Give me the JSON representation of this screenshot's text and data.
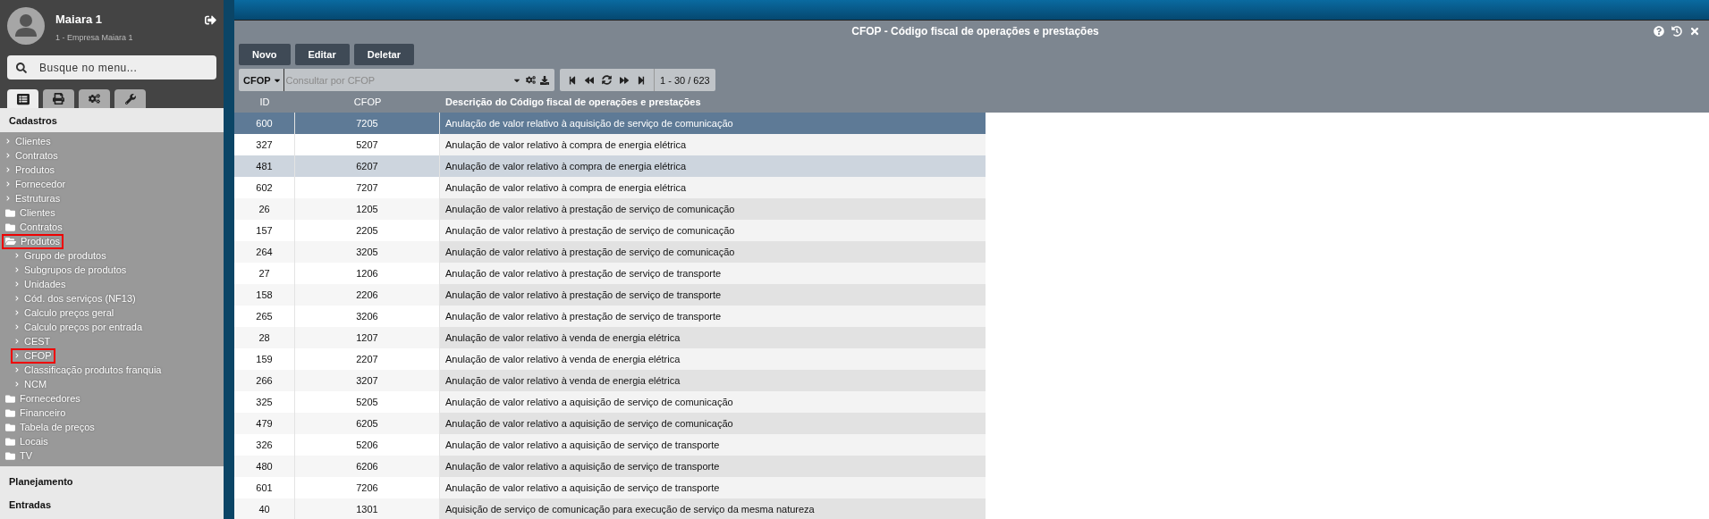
{
  "sidebar": {
    "user": {
      "name": "Maiara 1",
      "company": "1 - Empresa Maiara 1"
    },
    "search": {
      "placeholder": "Busque no menu..."
    },
    "tabs": [
      {
        "kind": "list",
        "selected": true
      },
      {
        "kind": "print",
        "selected": false
      },
      {
        "kind": "gears",
        "selected": false
      },
      {
        "kind": "wrench",
        "selected": false
      }
    ],
    "sections": [
      {
        "title": "Cadastros",
        "items": [
          {
            "kind": "link",
            "label": "Clientes",
            "marked": false
          },
          {
            "kind": "link",
            "label": "Contratos",
            "marked": false
          },
          {
            "kind": "link",
            "label": "Produtos",
            "marked": false
          },
          {
            "kind": "link",
            "label": "Fornecedor",
            "marked": false
          },
          {
            "kind": "link",
            "label": "Estruturas",
            "marked": false
          },
          {
            "kind": "folder",
            "label": "Clientes",
            "open": false,
            "marked": false
          },
          {
            "kind": "folder",
            "label": "Contratos",
            "open": false,
            "marked": false
          },
          {
            "kind": "folder",
            "label": "Produtos",
            "open": true,
            "marked": true,
            "children": [
              {
                "kind": "link",
                "label": "Grupo de produtos",
                "marked": false
              },
              {
                "kind": "link",
                "label": "Subgrupos de produtos",
                "marked": false
              },
              {
                "kind": "link",
                "label": "Unidades",
                "marked": false
              },
              {
                "kind": "link",
                "label": "Cód. dos serviços (NF13)",
                "marked": false
              },
              {
                "kind": "link",
                "label": "Calculo preços geral",
                "marked": false
              },
              {
                "kind": "link",
                "label": "Calculo preços por entrada",
                "marked": false
              },
              {
                "kind": "link",
                "label": "CEST",
                "marked": false
              },
              {
                "kind": "link",
                "label": "CFOP",
                "marked": true
              },
              {
                "kind": "link",
                "label": "Classificação produtos franquia",
                "marked": false
              },
              {
                "kind": "link",
                "label": "NCM",
                "marked": false
              }
            ]
          },
          {
            "kind": "folder",
            "label": "Fornecedores",
            "open": false,
            "marked": false
          },
          {
            "kind": "folder",
            "label": "Financeiro",
            "open": false,
            "marked": false
          },
          {
            "kind": "folder",
            "label": "Tabela de preços",
            "open": false,
            "marked": false
          },
          {
            "kind": "folder",
            "label": "Locais",
            "open": false,
            "marked": false
          },
          {
            "kind": "folder",
            "label": "TV",
            "open": false,
            "marked": false
          }
        ]
      },
      {
        "title": "Planejamento"
      },
      {
        "title": "Entradas"
      }
    ]
  },
  "window": {
    "title": "CFOP - Código fiscal de operações e prestações",
    "buttons": [
      "Novo",
      "Editar",
      "Deletar"
    ],
    "filter": {
      "field": "CFOP",
      "placeholder": "Consultar por CFOP"
    },
    "pager": "1 - 30 / 623",
    "table": {
      "columns": [
        "ID",
        "CFOP",
        "Descrição do Código fiscal de operações e prestações"
      ],
      "rows": [
        {
          "cells": [
            "600",
            "7205",
            "Anulação de valor relativo à aquisição de serviço de comunicação"
          ],
          "selected": true,
          "hovered": false
        },
        {
          "cells": [
            "327",
            "5207",
            "Anulação de valor relativo à compra de energia elétrica"
          ],
          "selected": false,
          "hovered": false
        },
        {
          "cells": [
            "481",
            "6207",
            "Anulação de valor relativo à compra de energia elétrica"
          ],
          "selected": false,
          "hovered": true
        },
        {
          "cells": [
            "602",
            "7207",
            "Anulação de valor relativo à compra de energia elétrica"
          ],
          "selected": false,
          "hovered": false
        },
        {
          "cells": [
            "26",
            "1205",
            "Anulação de valor relativo à prestação de serviço de comunicação"
          ],
          "selected": false,
          "hovered": false
        },
        {
          "cells": [
            "157",
            "2205",
            "Anulação de valor relativo à prestação de serviço de comunicação"
          ],
          "selected": false,
          "hovered": false
        },
        {
          "cells": [
            "264",
            "3205",
            "Anulação de valor relativo à prestação de serviço de comunicação"
          ],
          "selected": false,
          "hovered": false
        },
        {
          "cells": [
            "27",
            "1206",
            "Anulação de valor relativo à prestação de serviço de transporte"
          ],
          "selected": false,
          "hovered": false
        },
        {
          "cells": [
            "158",
            "2206",
            "Anulação de valor relativo à prestação de serviço de transporte"
          ],
          "selected": false,
          "hovered": false
        },
        {
          "cells": [
            "265",
            "3206",
            "Anulação de valor relativo à prestação de serviço de transporte"
          ],
          "selected": false,
          "hovered": false
        },
        {
          "cells": [
            "28",
            "1207",
            "Anulação de valor relativo à venda de energia elétrica"
          ],
          "selected": false,
          "hovered": false
        },
        {
          "cells": [
            "159",
            "2207",
            "Anulação de valor relativo à venda de energia elétrica"
          ],
          "selected": false,
          "hovered": false
        },
        {
          "cells": [
            "266",
            "3207",
            "Anulação de valor relativo à venda de energia elétrica"
          ],
          "selected": false,
          "hovered": false
        },
        {
          "cells": [
            "325",
            "5205",
            "Anulação de valor relativo a aquisição de serviço de comunicação"
          ],
          "selected": false,
          "hovered": false
        },
        {
          "cells": [
            "479",
            "6205",
            "Anulação de valor relativo a aquisição de serviço de comunicação"
          ],
          "selected": false,
          "hovered": false
        },
        {
          "cells": [
            "326",
            "5206",
            "Anulação de valor relativo a aquisição de serviço de transporte"
          ],
          "selected": false,
          "hovered": false
        },
        {
          "cells": [
            "480",
            "6206",
            "Anulação de valor relativo a aquisição de serviço de transporte"
          ],
          "selected": false,
          "hovered": false
        },
        {
          "cells": [
            "601",
            "7206",
            "Anulação de valor relativo a aquisição de serviço de transporte"
          ],
          "selected": false,
          "hovered": false
        },
        {
          "cells": [
            "40",
            "1301",
            "Aquisição de serviço de comunicação para execução de serviço da mesma natureza"
          ],
          "selected": false,
          "hovered": false
        }
      ]
    }
  }
}
